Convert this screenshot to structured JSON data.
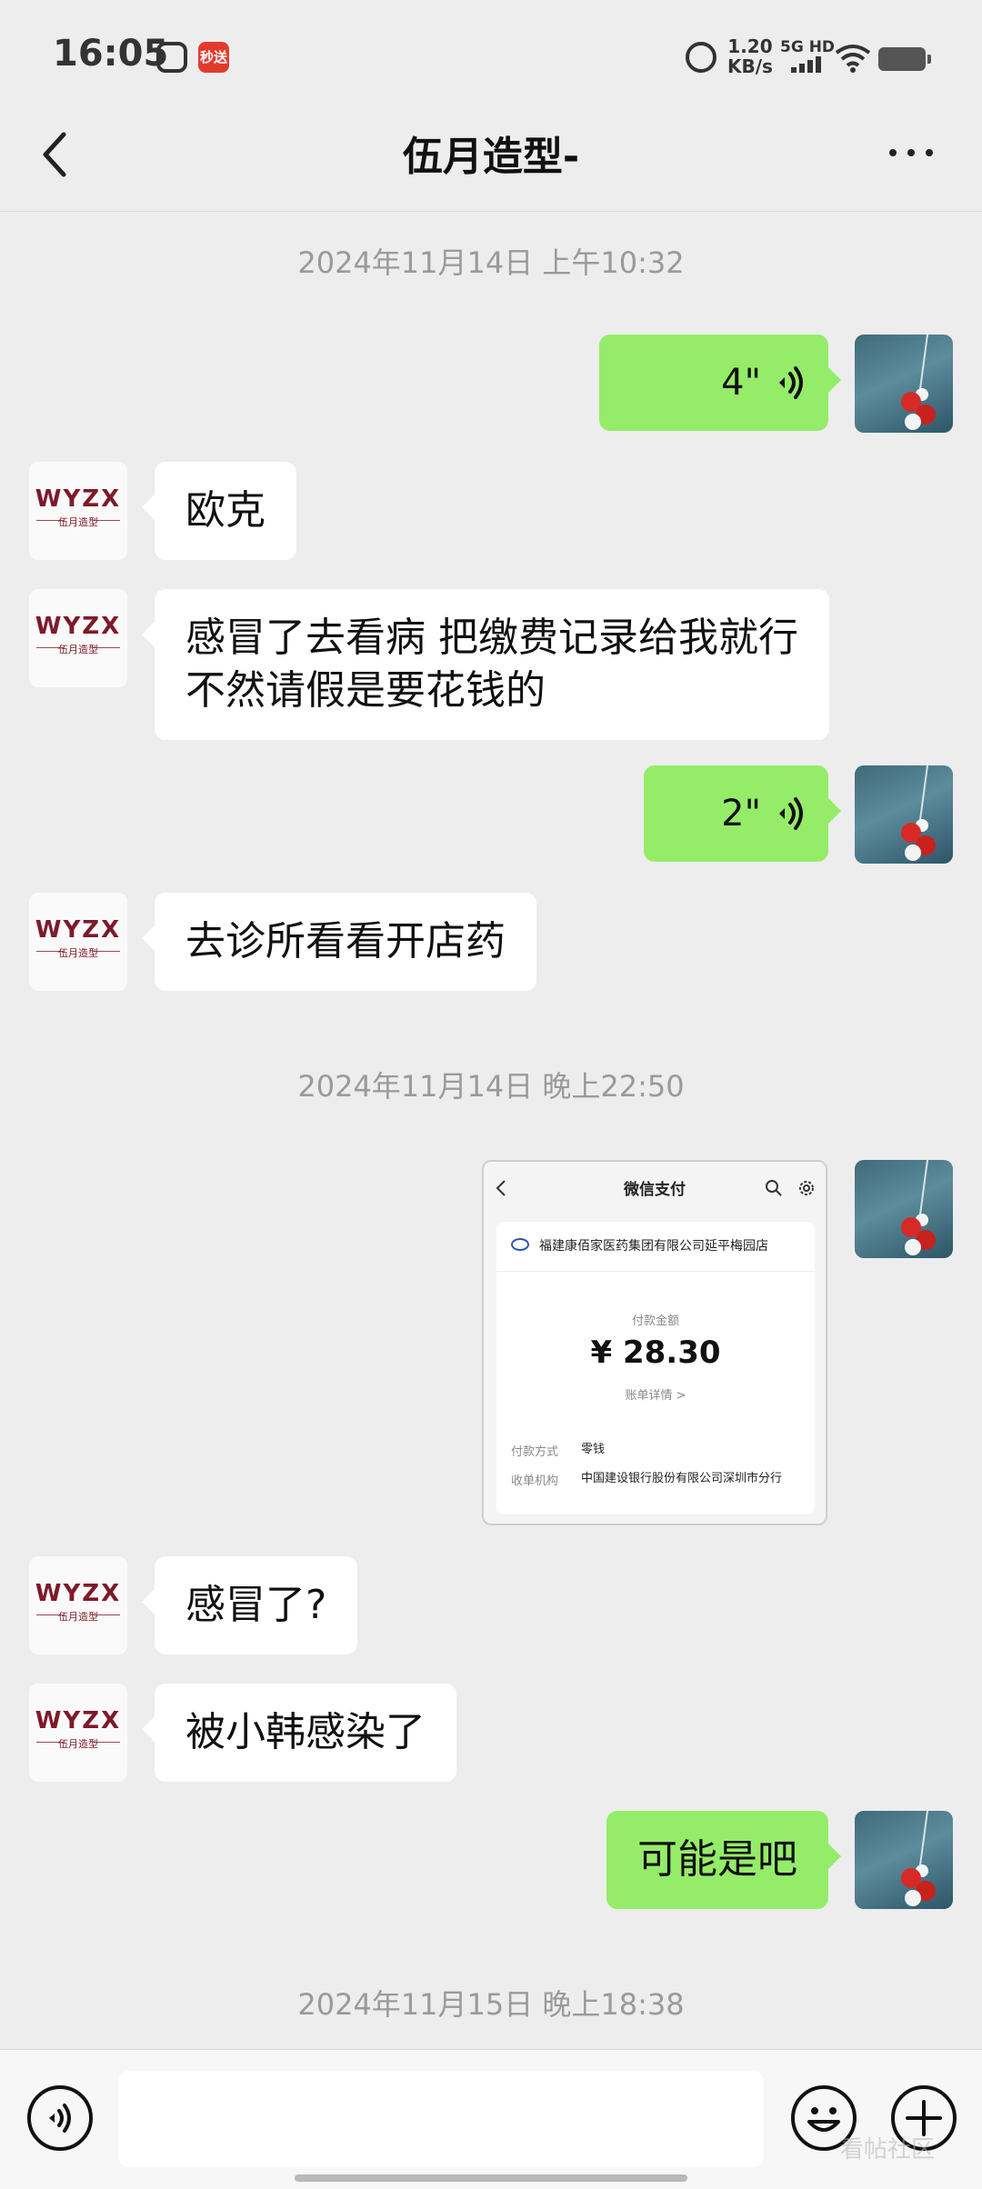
{
  "status_bar": {
    "time": "16:05",
    "app_badge": "秒送",
    "net_speed_value": "1.20",
    "net_speed_unit": "KB/s",
    "signal_label": "5G HD"
  },
  "nav": {
    "title": "伍月造型-"
  },
  "avatar_them": {
    "logo_text": "WYZX",
    "logo_sub": "伍月造型"
  },
  "messages": {
    "ts1": "2024年11月14日 上午10:32",
    "voice1_duration": "4\"",
    "m1": "欧克",
    "m2": "感冒了去看病  把缴费记录给我就行  不然请假是要花钱的",
    "voice2_duration": "2\"",
    "m3": "去诊所看看开店药",
    "ts2": "2024年11月14日 晚上22:50",
    "m4": "感冒了?",
    "m5": "被小韩感染了",
    "m6": "可能是吧",
    "ts3": "2024年11月15日 晚上18:38"
  },
  "payment": {
    "header": "微信支付",
    "merchant": "福建康佰家医药集团有限公司延平梅园店",
    "amount_label": "付款金额",
    "amount": "¥ 28.30",
    "detail_link": "账单详情 >",
    "method_label": "付款方式",
    "method_value": "零钱",
    "payee_label": "收单机构",
    "payee_value": "中国建设银行股份有限公司深圳市分行"
  },
  "input": {
    "placeholder": ""
  },
  "watermark": "看帖社区",
  "colors": {
    "background": "#ededed",
    "bubble_out": "#95ec69",
    "bubble_in": "#ffffff",
    "timestamp": "#9a9a9a"
  },
  "icons": {
    "back": "chevron-left-icon",
    "more": "more-dots-icon",
    "voice_wave": "voice-wave-icon",
    "voice_input": "voice-input-icon",
    "emoji": "emoji-icon",
    "plus": "plus-icon"
  }
}
